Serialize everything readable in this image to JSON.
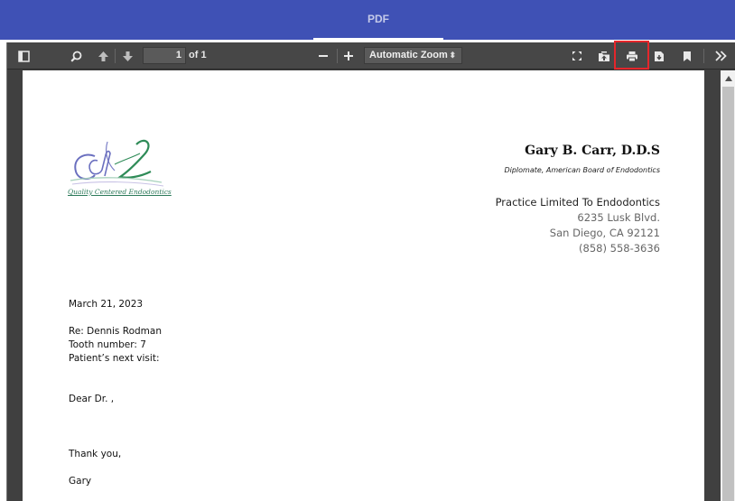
{
  "app": {
    "tab_label": "PDF"
  },
  "toolbar": {
    "page_number": "1",
    "page_of": "of 1",
    "zoom": "Automatic Zoom",
    "icons": [
      "sidebar-toggle-icon",
      "search-icon",
      "previous-page-icon",
      "next-page-icon",
      "zoom-out-icon",
      "zoom-in-icon",
      "presentation-mode-icon",
      "open-file-icon",
      "print-icon",
      "download-icon",
      "bookmark-icon",
      "tools-icon"
    ],
    "highlight_color": "#e5262b"
  },
  "letter": {
    "logo_caption": "Quality Centered Endodontics",
    "doctor_name": "Gary B. Carr, D.D.S",
    "credential": "Diplomate, American Board of Endodontics",
    "practice": "Practice Limited To Endodontics",
    "street": "6235 Lusk Blvd.",
    "city": "San Diego, CA 92121",
    "phone": "(858) 558-3636",
    "date": "March 21, 2023",
    "re": "Re: Dennis Rodman",
    "tooth": "Tooth number: 7",
    "next_visit": "Patient’s next visit:",
    "salutation": "Dear Dr. ,",
    "closing": "Thank you,",
    "signature": "Gary"
  }
}
